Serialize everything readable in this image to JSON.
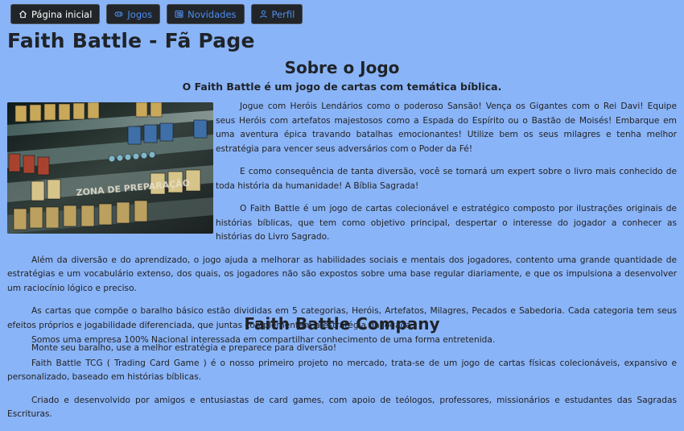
{
  "nav": {
    "items": [
      {
        "label": "Página inicial",
        "icon": "home-icon"
      },
      {
        "label": "Jogos",
        "icon": "gamepad-icon"
      },
      {
        "label": "Novidades",
        "icon": "newspaper-icon"
      },
      {
        "label": "Perfil",
        "icon": "user-icon"
      }
    ]
  },
  "page": {
    "title": "Faith Battle - Fã Page"
  },
  "about": {
    "heading": "Sobre o Jogo",
    "subtitle": "O Faith Battle é um jogo de cartas com temática bíblica.",
    "image_alt": "Faith Battle game board",
    "image_text": "ZONA DE PREPARAÇÃO",
    "paragraphs": [
      "Jogue com Heróis Lendários como o poderoso Sansão! Vença os Gigantes com o Rei Davi! Equipe seus Heróis com artefatos majestosos como a Espada do Espírito ou o Bastão de Moisés! Embarque em uma aventura épica travando batalhas emocionantes! Utilize bem os seus milagres e tenha melhor estratégia para vencer seus adversários com o Poder da Fé!",
      "E como consequência de tanta diversão, você se tornará um expert sobre o livro mais conhecido de toda história da humanidade! A Bíblia Sagrada!",
      "O Faith Battle é um jogo de cartas colecionável e estratégico composto por ilustrações originais de histórias bíblicas, que tem como objetivo principal, despertar o interesse do jogador a conhecer as histórias do Livro Sagrado.",
      "Além da diversão e do aprendizado, o jogo ajuda a melhorar as habilidades sociais e mentais dos jogadores, contento uma grande quantidade de estratégias e um vocabulário extenso, dos quais, os jogadores não são expostos sobre uma base regular diariamente, e que os impulsiona a desenvolver um raciocínio lógico e preciso.",
      "As cartas que compõe o baralho básico estão divididas em 5 categorias, Heróis, Artefatos, Milagres, Pecados e Sabedoria. Cada categoria tem seus efeitos próprios e jogabilidade diferenciada, que juntas complementam a estratégia da jogada.",
      "Monte seu baralho, use a melhor estratégia e preparece para diversão!"
    ]
  },
  "company": {
    "heading": "Faith Battle Company",
    "paragraphs": [
      "Somos uma empresa 100% Nacional interessada em compartilhar conhecimento de uma forma entretenida.",
      "Faith Battle TCG ( Trading Card Game ) é o nosso primeiro projeto no mercado, trata-se de um jogo de cartas físicas colecionáveis, expansivo e personalizado, baseado em histórias bíblicas.",
      "Criado e desenvolvido por amigos e entusiastas de card games, com apoio de teólogos, professores, missionários e estudantes das Sagradas Escrituras."
    ]
  }
}
